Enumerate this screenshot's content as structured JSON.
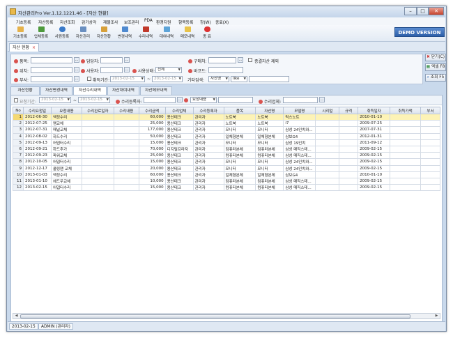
{
  "window": {
    "title": "자산관리Pro Ver.1.12.1221.46 - [자산 현황]",
    "min": "–",
    "max": "□",
    "close": "✕"
  },
  "menu": [
    "기초등록",
    "자산등록",
    "자산조회",
    "감가상각",
    "재물조사",
    "보조관리",
    "PDA",
    "환경지원",
    "항목등록",
    "창(W)",
    "종료(X)"
  ],
  "toolbar": [
    "기초등록",
    "업체등록",
    "사원등록",
    "자산관리",
    "자산현황",
    "변경내역",
    "수리내역",
    "대여내역",
    "메모내역",
    "종 료"
  ],
  "colors": {
    "accent": "#2d5fa8",
    "selected_row": "#fdf3b6",
    "required_dot": "#d9534f"
  },
  "demo_label": "DEMO VERSION",
  "doc_tab": {
    "label": "자산 현황",
    "close": "×"
  },
  "filter": {
    "item": "품목:",
    "manager": "담당자:",
    "vendor": "구매처:",
    "exclude_label": "종결자산 제외",
    "location": "위치:",
    "user": "사용자:",
    "status": "사용상태:",
    "status_value": "전체",
    "barcode": "바코드:",
    "dept": "부서:",
    "acq_label": "취득기간:",
    "date_from": "2013-02-15",
    "date_to": "2013-02-15",
    "tilde": "~",
    "other": "기타검색:",
    "other_field": "자산명",
    "other_op": "like"
  },
  "buttons": {
    "close": "닫기(C)",
    "excel": "엑셀 F8",
    "search": "조회 F5"
  },
  "subtabs": [
    "자산현황",
    "자산변경내역",
    "자산수리내역",
    "자산대여내역",
    "자산메모내역"
  ],
  "repair_filter": {
    "request_period": "요청기간:",
    "date_from": "2013-02-15",
    "date_to": "2013-02-15",
    "registrant": "수리등록자:",
    "status": "요청내용",
    "vendor": "수리업체:"
  },
  "columns": [
    "No",
    "수리요청일",
    "요청내용",
    "수리완료일자",
    "수리내용",
    "수리금액",
    "수리업체",
    "수리등록자",
    "품목",
    "자산명",
    "모델명",
    "시리얼",
    "규격",
    "취득일자",
    "취득가액",
    "부서"
  ],
  "rows": [
    [
      "1",
      "2012-06-30",
      "액정수리",
      "",
      "",
      "60,000",
      "용산테크",
      "관리자",
      "노트북",
      "노트북",
      "럭스노트",
      "",
      "",
      "2010-01-10",
      "",
      ""
    ],
    [
      "2",
      "2012-07-25",
      "램교체",
      "",
      "",
      "25,000",
      "용산테크",
      "관리자",
      "노트북",
      "노트북",
      "i7",
      "",
      "",
      "2009-07-25",
      "",
      ""
    ],
    [
      "3",
      "2012-07-31",
      "패널교체",
      "",
      "",
      "177,000",
      "용산테크",
      "관리자",
      "모니터",
      "모니터",
      "삼성 24인치와...",
      "",
      "",
      "2007-07-31",
      "",
      ""
    ],
    [
      "4",
      "2012-08-02",
      "하드수리",
      "",
      "",
      "50,000",
      "용산테크",
      "관리자",
      "일체형본체",
      "일체형본체",
      "삼보G4",
      "",
      "",
      "2012-01-31",
      "",
      ""
    ],
    [
      "5",
      "2012-09-13",
      "어댑터수리",
      "",
      "",
      "15,000",
      "용산테크",
      "관리자",
      "모니터",
      "모니터",
      "삼성 19인치",
      "",
      "",
      "2011-09-12",
      "",
      ""
    ],
    [
      "6",
      "2012-09-21",
      "하드추가",
      "",
      "",
      "70,000",
      "디지털프라자",
      "관리자",
      "컴퓨터본체",
      "컴퓨터본체",
      "삼성 매직스테...",
      "",
      "",
      "2009-02-15",
      "",
      ""
    ],
    [
      "7",
      "2012-09-23",
      "파워교체",
      "",
      "",
      "25,000",
      "용산테크",
      "관리자",
      "컴퓨터본체",
      "컴퓨터본체",
      "삼성 매직스테...",
      "",
      "",
      "2009-02-15",
      "",
      ""
    ],
    [
      "8",
      "2012-10-05",
      "어댑터수리",
      "",
      "",
      "15,000",
      "용산테크",
      "관리자",
      "모니터",
      "모니터",
      "삼성 24인치와...",
      "",
      "",
      "2009-02-15",
      "",
      ""
    ],
    [
      "9",
      "2012-12-17",
      "쿨링팬 교체",
      "",
      "",
      "20,000",
      "용산테크",
      "관리자",
      "모니터",
      "모니터",
      "삼성 24인치와...",
      "",
      "",
      "2009-02-15",
      "",
      ""
    ],
    [
      "10",
      "2013-01-03",
      "액정수리",
      "",
      "",
      "60,000",
      "용산테크",
      "관리자",
      "일체형본체",
      "일체형본체",
      "삼보G4",
      "",
      "",
      "2010-01-10",
      "",
      ""
    ],
    [
      "11",
      "2013-01-10",
      "헤드우교체",
      "",
      "",
      "10,000",
      "용산테크",
      "관리자",
      "컴퓨터본체",
      "컴퓨터본체",
      "삼성 매직스테...",
      "",
      "",
      "2009-02-15",
      "",
      ""
    ],
    [
      "12",
      "2013-02-15",
      "어댑터수리",
      "",
      "",
      "15,000",
      "용산테크",
      "관리자",
      "컴퓨터본체",
      "컴퓨터본체",
      "삼성 매직스테...",
      "",
      "",
      "2009-02-15",
      "",
      ""
    ]
  ],
  "status_bar": {
    "date": "2013-02-15",
    "user": "ADMIN (관리자)"
  }
}
